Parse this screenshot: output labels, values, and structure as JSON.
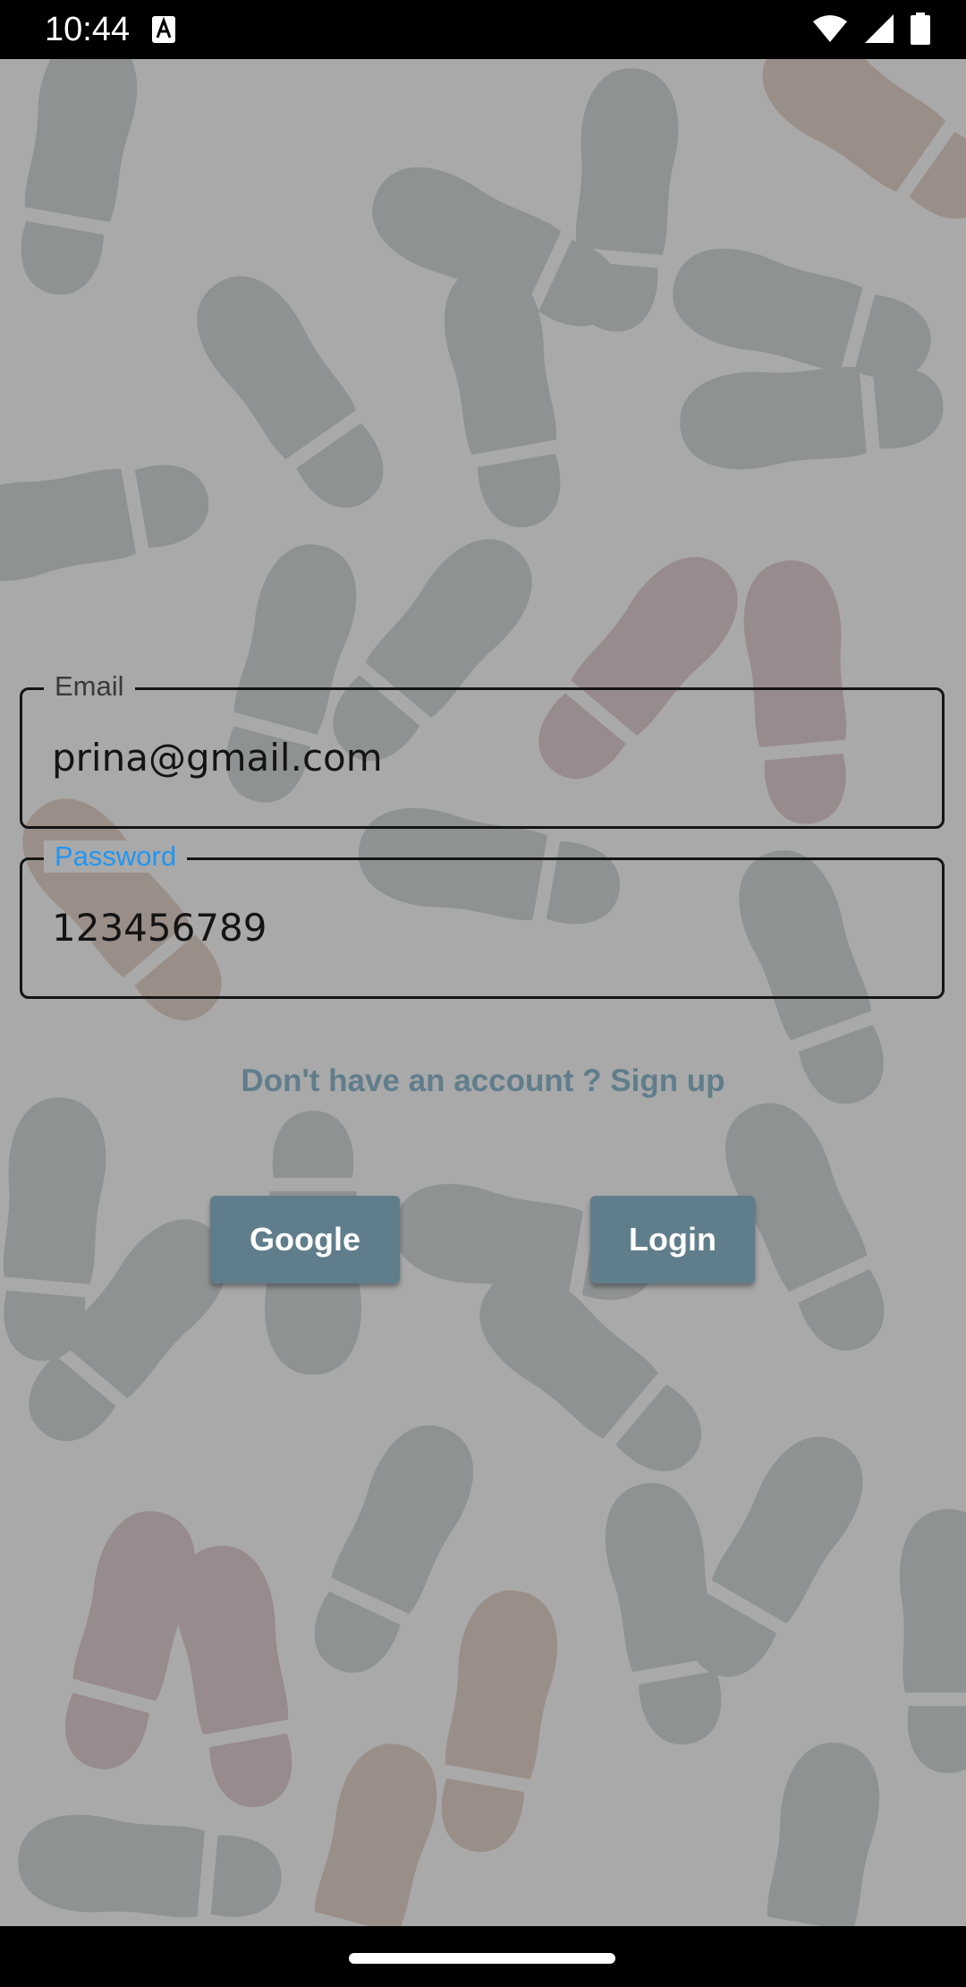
{
  "status_bar": {
    "time": "10:44"
  },
  "form": {
    "email": {
      "label": "Email",
      "value": "prina@gmail.com"
    },
    "password": {
      "label": "Password",
      "value": "123456789"
    }
  },
  "signup_link": "Don't have an account ? Sign up",
  "buttons": {
    "google": "Google",
    "login": "Login"
  },
  "colors": {
    "accent": "#607d8b",
    "focused_label": "#2196f3",
    "background": "#a9a9a9"
  }
}
